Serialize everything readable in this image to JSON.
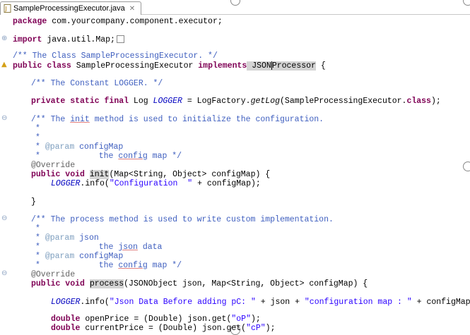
{
  "tab": {
    "title": "SampleProcessingExecutor.java",
    "close_glyph": "✕",
    "icon": "java-file-icon"
  },
  "code": {
    "package_kw": "package",
    "package_name": " com.yourcompany.component.executor;",
    "import_kw": "import",
    "import_name": " java.util.Map;",
    "class_comment": "/** The Class SampleProcessingExecutor. */",
    "class_decl": {
      "public": "public",
      "class": "class",
      "name_sp": " SampleProcessingExecutor ",
      "implements": "implements",
      "iface_a": " JSON",
      "iface_b": "Processor",
      "brace": " {"
    },
    "logger_comment": "/** The Constant LOGGER. */",
    "logger_decl": {
      "mods": "private static final",
      "type": " Log ",
      "field": "LOGGER",
      "eq": " = LogFactory.",
      "method": "getLog",
      "arg": "(SampleProcessingExecutor.",
      "cls": "class",
      "end": ");"
    },
    "init_doc": {
      "l1a": "/** The ",
      "l1b": "init",
      "l1c": " method is used to initialize the configuration.",
      "star": "*",
      "param_tag": "@param",
      "param_name": " configMap",
      "desc_a": "the ",
      "desc_b": "config",
      "desc_c": " map */"
    },
    "override": "@Override",
    "init_sig": {
      "mods": "public void",
      "name": "init",
      "rest": "(Map<String, Object> configMap) {"
    },
    "init_body": {
      "field": "LOGGER",
      "call": ".info(",
      "str": "\"Configuration  \"",
      "rest": " + configMap);"
    },
    "close_brace": "}",
    "process_doc": {
      "l1": "/** The process method is used to write custom implementation.",
      "star": "*",
      "param1_tag": "@param",
      "param1_name": " json",
      "desc1_a": "the ",
      "desc1_b": "json",
      "desc1_c": " data",
      "param2_tag": "@param",
      "param2_name": " configMap",
      "desc2_a": "the ",
      "desc2_b": "config",
      "desc2_c": " map */"
    },
    "process_sig": {
      "mods": "public void",
      "name": "process",
      "rest": "(JSONObject json, Map<String, Object> configMap) {"
    },
    "log_line": {
      "field": "LOGGER",
      "call": ".info(",
      "str1": "\"Json Data Before adding pC: \"",
      "mid": " + json + ",
      "str2": "\"configuration map : \"",
      "rest": " + configMap);"
    },
    "open_price": {
      "type": "double",
      "rest": " openPrice = (Double) json.get(",
      "str": "\"oP\"",
      "end": ");"
    },
    "current_price": {
      "type": "double",
      "rest": " currentPrice = (Double) json.get(",
      "str": "\"cP\"",
      "end": ");"
    }
  },
  "colors": {
    "keyword": "#7f0055",
    "comment": "#3f5fbf",
    "string": "#2a00ff",
    "field": "#0000c0"
  }
}
